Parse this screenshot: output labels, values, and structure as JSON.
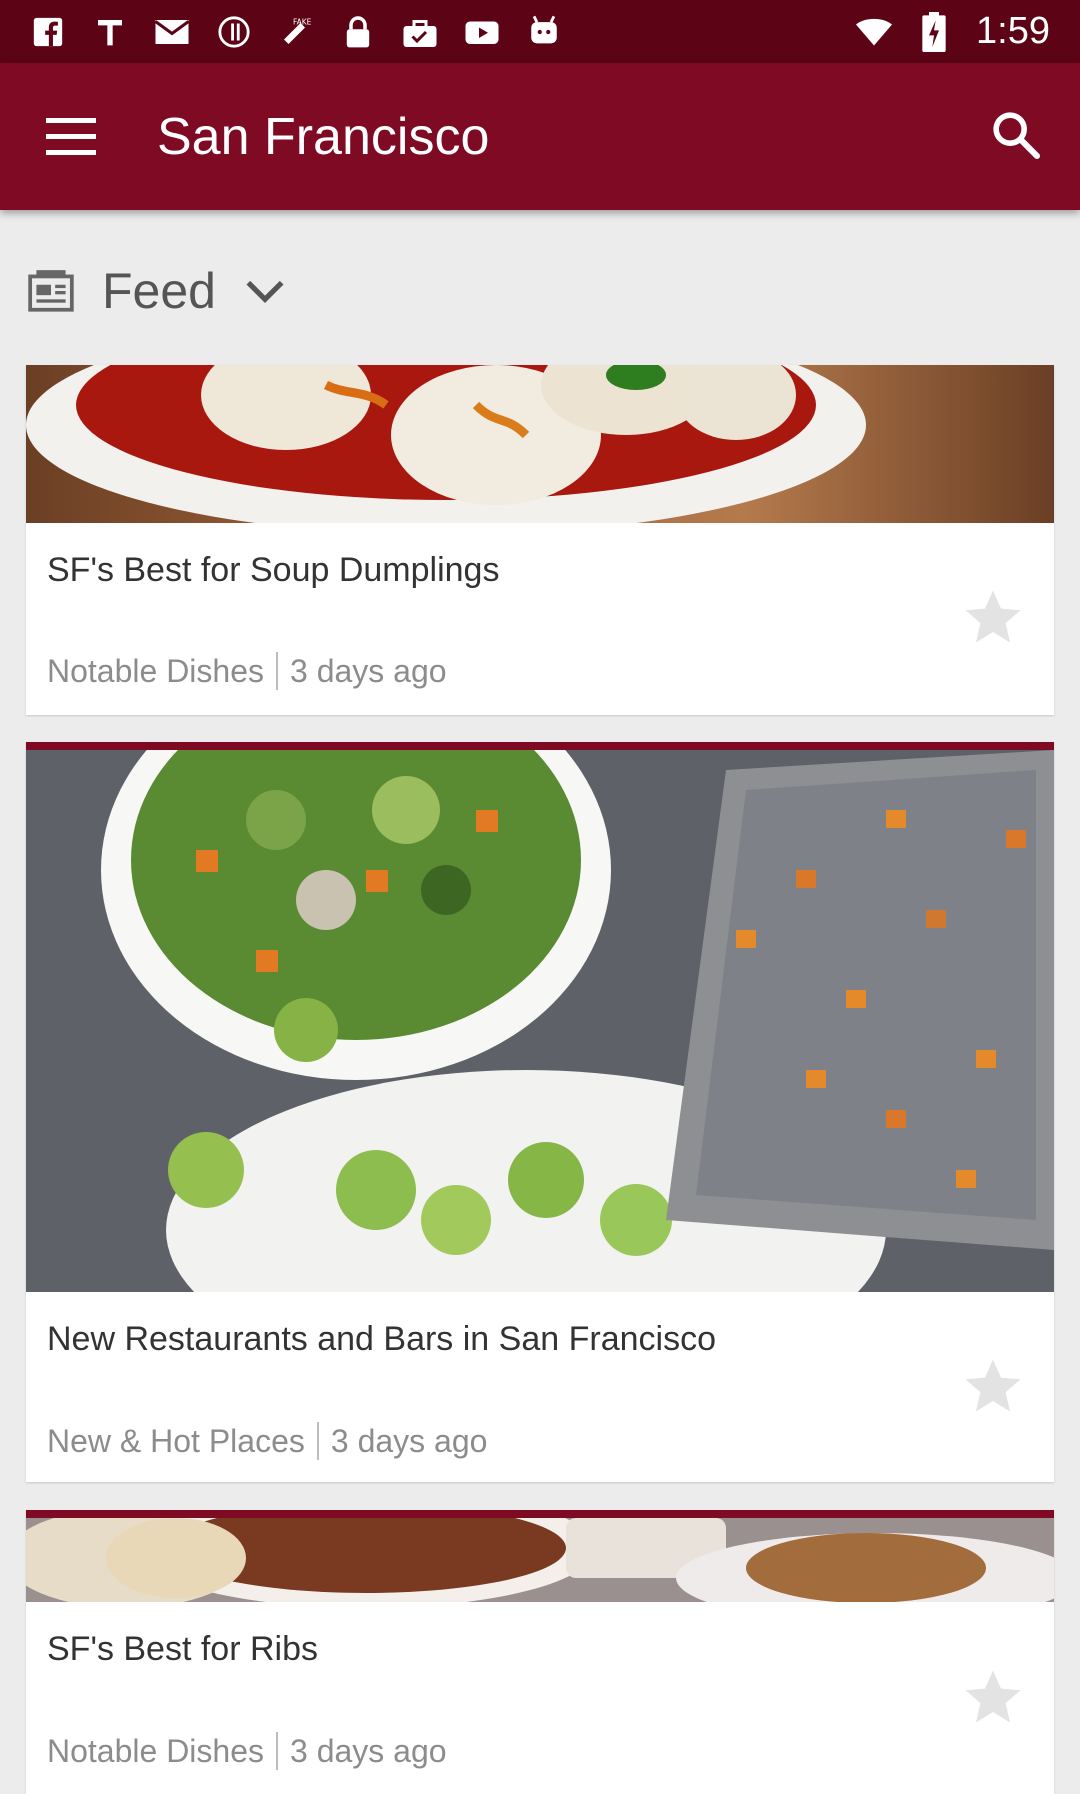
{
  "status_bar": {
    "time": "1:59",
    "left_icons": [
      "facebook-icon",
      "t-icon",
      "mail-icon",
      "p-icon",
      "fake-gps-icon",
      "lock-icon",
      "bag-check-icon",
      "youtube-icon",
      "android-icon"
    ],
    "right_icons": [
      "wifi-icon",
      "battery-charging-icon"
    ]
  },
  "app_bar": {
    "title": "San Francisco",
    "menu_icon": "hamburger-menu-icon",
    "search_icon": "search-icon",
    "color": "#7e0a24"
  },
  "feed_selector": {
    "label": "Feed",
    "icon": "newspaper-icon",
    "dropdown_icon": "chevron-down-icon"
  },
  "cards": [
    {
      "title": "SF's Best for Soup Dumplings",
      "category": "Notable Dishes",
      "time": "3 days ago",
      "image": "soup dumplings in chili oil"
    },
    {
      "title": "New Restaurants and Bars in San Francisco",
      "category": "New & Hot Places",
      "time": "3 days ago",
      "image": "salad bowl, brussels sprouts and roasted sweet potatoes"
    },
    {
      "title": "SF's Best for Ribs",
      "category": "Notable Dishes",
      "time": "3 days ago",
      "image": "ribs meal with beans and bread"
    }
  ]
}
